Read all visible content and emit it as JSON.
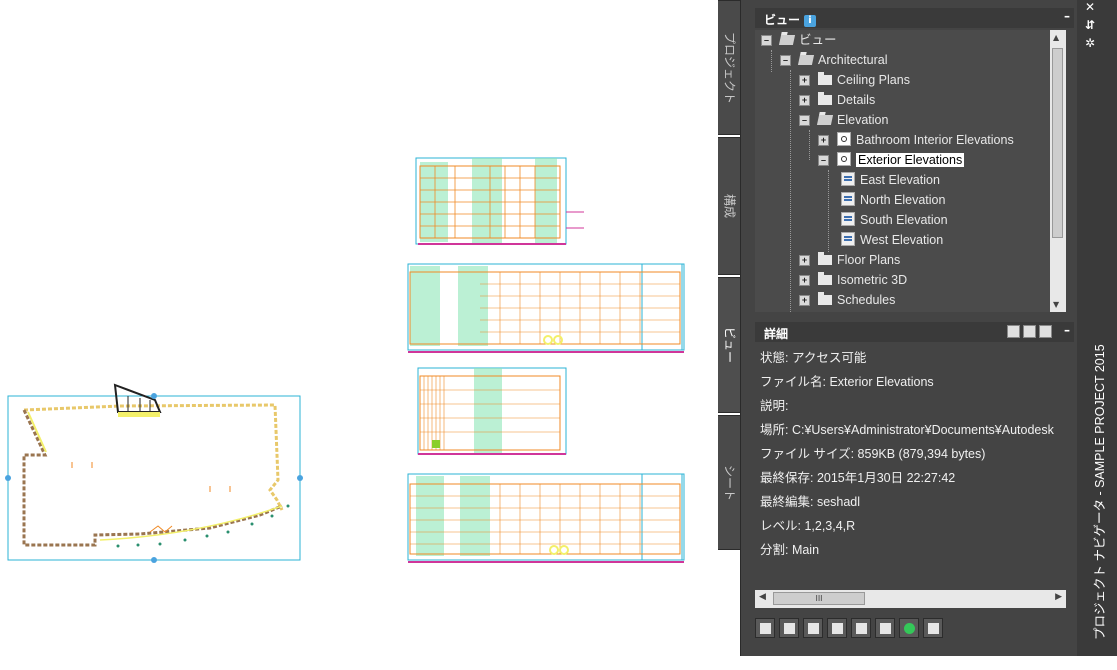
{
  "side_tabs": [
    "プロジェクト",
    "構成",
    "ビュー",
    "シート"
  ],
  "views_section": {
    "title": "ビュー",
    "minimize": "–"
  },
  "tree": [
    {
      "label": "ビュー",
      "expander": "–",
      "icon": "folder-open-icon",
      "level": 0
    },
    {
      "label": "Architectural",
      "expander": "–",
      "icon": "folder-open-icon",
      "level": 1
    },
    {
      "label": "Ceiling Plans",
      "expander": "+",
      "icon": "folder-icon",
      "level": 2
    },
    {
      "label": "Details",
      "expander": "+",
      "icon": "folder-icon",
      "level": 2
    },
    {
      "label": "Elevation",
      "expander": "–",
      "icon": "folder-open-icon",
      "level": 2
    },
    {
      "label": "Bathroom Interior Elevations",
      "expander": "+",
      "icon": "view-type-icon",
      "level": 3
    },
    {
      "label": "Exterior Elevations",
      "expander": "–",
      "icon": "view-type-locked-icon",
      "level": 3,
      "selected": true
    },
    {
      "label": "East Elevation",
      "expander": "",
      "icon": "elevation-view-icon",
      "level": 4
    },
    {
      "label": "North Elevation",
      "expander": "",
      "icon": "elevation-view-icon",
      "level": 4
    },
    {
      "label": "South Elevation",
      "expander": "",
      "icon": "elevation-view-icon",
      "level": 4
    },
    {
      "label": "West Elevation",
      "expander": "",
      "icon": "elevation-view-icon",
      "level": 4
    },
    {
      "label": "Floor Plans",
      "expander": "+",
      "icon": "folder-icon",
      "level": 2
    },
    {
      "label": "Isometric 3D",
      "expander": "+",
      "icon": "folder-icon",
      "level": 2
    },
    {
      "label": "Schedules",
      "expander": "+",
      "icon": "folder-icon",
      "level": 2
    }
  ],
  "details_section": {
    "title": "詳細",
    "minimize": "–"
  },
  "details": [
    "状態: アクセス可能",
    "ファイル名: Exterior Elevations",
    "説明:",
    "場所: C:¥Users¥Administrator¥Documents¥Autodesk",
    "ファイル サイズ: 859KB (879,394 bytes)",
    "最終保存: 2015年1月30日  22:27:42",
    "最終編集: seshadl",
    "レベル: 1,2,3,4,R",
    "分割: Main"
  ],
  "hscroll_grip": "III",
  "palette_title": "プロジェクト ナビゲータ - SAMPLE PROJECT 2015",
  "title_controls": [
    "✕",
    "⇵",
    "✲"
  ],
  "colors": {
    "palette_bg": "#444444",
    "tree_bg": "#4b4b4b",
    "drawing_orange": "#f08a24",
    "drawing_cyan": "#2bb3d6",
    "drawing_green_fill": "#8ee6b8",
    "drawing_magenta": "#d0359a"
  }
}
